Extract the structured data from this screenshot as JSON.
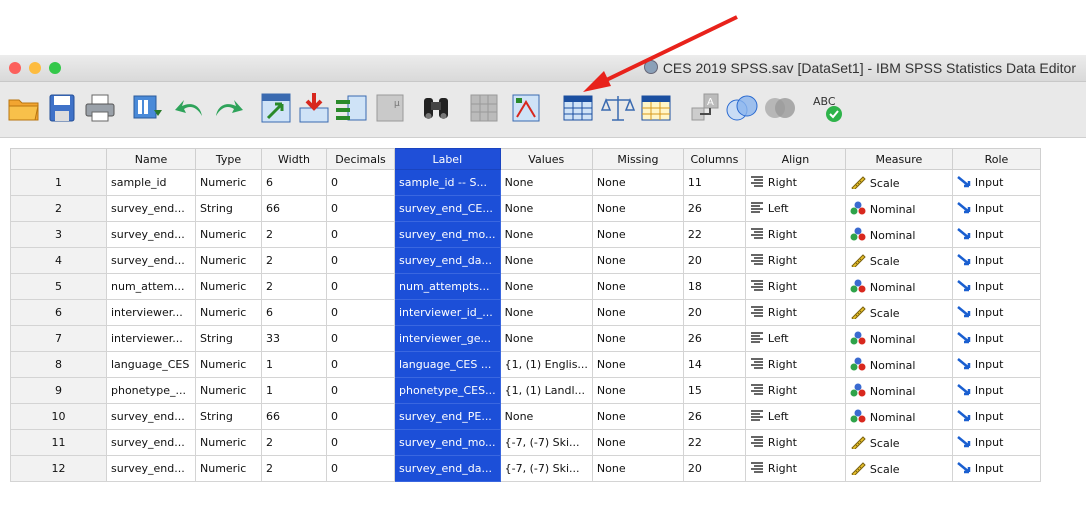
{
  "window": {
    "title": "CES 2019 SPSS.sav [DataSet1] - IBM SPSS Statistics Data Editor",
    "icon": "spss-document-icon"
  },
  "toolbar": {
    "buttons": [
      {
        "name": "open-file-button",
        "icon": "folder-icon"
      },
      {
        "name": "save-button",
        "icon": "save-icon"
      },
      {
        "name": "print-button",
        "icon": "printer-icon"
      },
      {
        "name": "recall-dialog-button",
        "icon": "dialog-recall-icon"
      },
      {
        "name": "undo-button",
        "icon": "undo-icon"
      },
      {
        "name": "redo-button",
        "icon": "redo-icon"
      },
      {
        "name": "go-to-case-button",
        "icon": "goto-case-icon"
      },
      {
        "name": "go-to-variable-button",
        "icon": "goto-variable-icon"
      },
      {
        "name": "variables-button",
        "icon": "variables-icon"
      },
      {
        "name": "run-descriptives-button",
        "icon": "descriptives-icon"
      },
      {
        "name": "find-button",
        "icon": "binoculars-icon"
      },
      {
        "name": "insert-cases-button",
        "icon": "insert-cases-icon"
      },
      {
        "name": "insert-variable-button",
        "icon": "insert-variable-icon"
      },
      {
        "name": "split-file-button",
        "icon": "split-file-icon"
      },
      {
        "name": "weight-cases-button",
        "icon": "scale-balance-icon"
      },
      {
        "name": "select-cases-button",
        "icon": "select-cases-icon"
      },
      {
        "name": "value-labels-button",
        "icon": "value-labels-icon"
      },
      {
        "name": "use-variable-sets-button",
        "icon": "variable-sets-icon"
      },
      {
        "name": "show-all-variables-button",
        "icon": "show-all-variables-icon"
      },
      {
        "name": "spelling-button",
        "icon": "spellcheck-icon",
        "text": "ABC"
      }
    ]
  },
  "grid": {
    "selected_column": "Label",
    "columns": [
      "",
      "Name",
      "Type",
      "Width",
      "Decimals",
      "Label",
      "Values",
      "Missing",
      "Columns",
      "Align",
      "Measure",
      "Role"
    ],
    "rows": [
      [
        "1",
        "sample_id",
        "Numeric",
        "6",
        "0",
        "sample_id -- S...",
        "None",
        "None",
        "11",
        "Right",
        "Scale",
        "Input"
      ],
      [
        "2",
        "survey_end...",
        "String",
        "66",
        "0",
        "survey_end_CE...",
        "None",
        "None",
        "26",
        "Left",
        "Nominal",
        "Input"
      ],
      [
        "3",
        "survey_end...",
        "Numeric",
        "2",
        "0",
        "survey_end_mo...",
        "None",
        "None",
        "22",
        "Right",
        "Nominal",
        "Input"
      ],
      [
        "4",
        "survey_end...",
        "Numeric",
        "2",
        "0",
        "survey_end_da...",
        "None",
        "None",
        "20",
        "Right",
        "Scale",
        "Input"
      ],
      [
        "5",
        "num_attem...",
        "Numeric",
        "2",
        "0",
        "num_attempts...",
        "None",
        "None",
        "18",
        "Right",
        "Nominal",
        "Input"
      ],
      [
        "6",
        "interviewer...",
        "Numeric",
        "6",
        "0",
        "interviewer_id_...",
        "None",
        "None",
        "20",
        "Right",
        "Scale",
        "Input"
      ],
      [
        "7",
        "interviewer...",
        "String",
        "33",
        "0",
        "interviewer_ge...",
        "None",
        "None",
        "26",
        "Left",
        "Nominal",
        "Input"
      ],
      [
        "8",
        "language_CES",
        "Numeric",
        "1",
        "0",
        "language_CES ...",
        "{1, (1) Englis...",
        "None",
        "14",
        "Right",
        "Nominal",
        "Input"
      ],
      [
        "9",
        "phonetype_...",
        "Numeric",
        "1",
        "0",
        "phonetype_CES...",
        "{1, (1) Landl...",
        "None",
        "15",
        "Right",
        "Nominal",
        "Input"
      ],
      [
        "10",
        "survey_end...",
        "String",
        "66",
        "0",
        "survey_end_PE...",
        "None",
        "None",
        "26",
        "Left",
        "Nominal",
        "Input"
      ],
      [
        "11",
        "survey_end...",
        "Numeric",
        "2",
        "0",
        "survey_end_mo...",
        "{-7, (-7) Ski...",
        "None",
        "22",
        "Right",
        "Scale",
        "Input"
      ],
      [
        "12",
        "survey_end...",
        "Numeric",
        "2",
        "0",
        "survey_end_da...",
        "{-7, (-7) Ski...",
        "None",
        "20",
        "Right",
        "Scale",
        "Input"
      ]
    ]
  },
  "colors": {
    "selection": "#1f4fd8",
    "annotation_arrow": "#e8221b",
    "traffic_close": "#fc605c",
    "traffic_minimize": "#fdbc40",
    "traffic_zoom": "#34c84a"
  }
}
